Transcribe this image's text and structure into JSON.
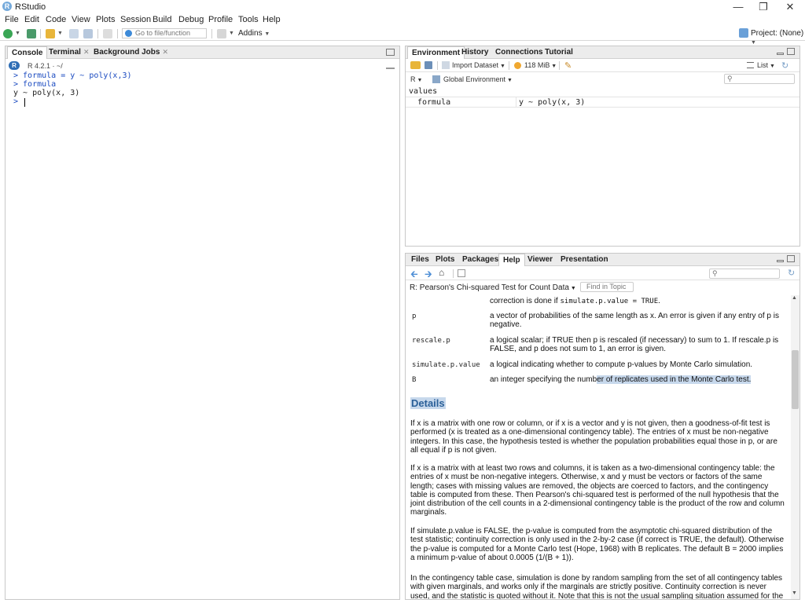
{
  "window": {
    "title": "RStudio",
    "app_icon": "R"
  },
  "menu": [
    "File",
    "Edit",
    "Code",
    "View",
    "Plots",
    "Session",
    "Build",
    "Debug",
    "Profile",
    "Tools",
    "Help"
  ],
  "toolbar": {
    "goto_placeholder": "Go to file/function",
    "addins_label": "Addins",
    "project_label": "Project: (None)"
  },
  "left_pane": {
    "tabs": [
      "Console",
      "Terminal",
      "Background Jobs"
    ],
    "r_version": "R 4.2.1 · ~/",
    "lines": [
      {
        "text": "> formula = y ~ poly(x,3)",
        "kind": "in"
      },
      {
        "text": "> formula",
        "kind": "in"
      },
      {
        "text": "y ~ poly(x, 3)",
        "kind": "out"
      },
      {
        "text": "> ",
        "kind": "in"
      }
    ]
  },
  "env_pane": {
    "tabs": [
      "Environment",
      "History",
      "Connections",
      "Tutorial"
    ],
    "import_label": "Import Dataset",
    "memory_label": "118 MiB",
    "list_label": "List",
    "lang_label": "R",
    "scope_label": "Global Environment",
    "section_header": "values",
    "rows": [
      {
        "name": "formula",
        "value": "y ~ poly(x, 3)"
      }
    ]
  },
  "help_pane": {
    "tabs": [
      "Files",
      "Plots",
      "Packages",
      "Help",
      "Viewer",
      "Presentation"
    ],
    "topic": "R: Pearson's Chi-squared Test for Count Data",
    "find_placeholder": "Find in Topic",
    "top_line": {
      "pre": "correction is done if ",
      "code": "simulate.p.value = TRUE",
      "post": "."
    },
    "args": [
      {
        "name": "p",
        "desc": "a vector of probabilities of the same length as x. An error is given if any entry of p is negative."
      },
      {
        "name": "rescale.p",
        "desc": "a logical scalar; if TRUE then p is rescaled (if necessary) to sum to 1. If rescale.p is FALSE, and p does not sum to 1, an error is given."
      },
      {
        "name": "simulate.p.value",
        "desc": "a logical indicating whether to compute p-values by Monte Carlo simulation."
      },
      {
        "name": "B",
        "desc_pre": "an integer specifying the numb",
        "desc_hl": "er of replicates used in the Monte Carlo test."
      }
    ],
    "details_heading": "Details",
    "paragraphs": [
      "If x is a matrix with one row or column, or if x is a vector and y is not given, then a goodness-of-fit test is performed (x is treated as a one-dimensional contingency table). The entries of x must be non-negative integers. In this case, the hypothesis tested is whether the population probabilities equal those in p, or are all equal if p is not given.",
      "If x is a matrix with at least two rows and columns, it is taken as a two-dimensional contingency table: the entries of x must be non-negative integers. Otherwise, x and y must be vectors or factors of the same length; cases with missing values are removed, the objects are coerced to factors, and the contingency table is computed from these. Then Pearson's chi-squared test is performed of the null hypothesis that the joint distribution of the cell counts in a 2-dimensional contingency table is the product of the row and column marginals.",
      "If simulate.p.value is FALSE, the p-value is computed from the asymptotic chi-squared distribution of the test statistic; continuity correction is only used in the 2-by-2 case (if correct is TRUE, the default). Otherwise the p-value is computed for a Monte Carlo test (Hope, 1968) with B replicates. The default B = 2000 implies a minimum p-value of about 0.0005 (1/(B + 1)).",
      "In the contingency table case, simulation is done by random sampling from the set of all contingency tables with given marginals, and works only if the marginals are strictly positive. Continuity correction is never used, and the statistic is quoted without it. Note that this is not the usual sampling situation assumed for the"
    ]
  }
}
